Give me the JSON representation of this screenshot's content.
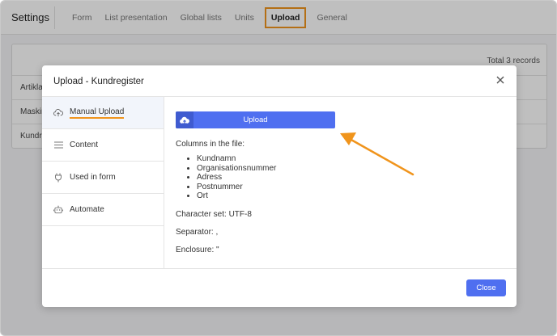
{
  "app": {
    "title": "Settings"
  },
  "tabs": [
    {
      "label": "Form"
    },
    {
      "label": "List presentation"
    },
    {
      "label": "Global lists"
    },
    {
      "label": "Units"
    },
    {
      "label": "Upload",
      "active": true
    },
    {
      "label": "General"
    }
  ],
  "background": {
    "total_records": "Total 3 records",
    "rows": [
      "Artiklar",
      "Maskin",
      "Kundre"
    ]
  },
  "modal": {
    "title": "Upload - Kundregister",
    "nav": [
      {
        "label": "Manual Upload",
        "icon": "cloud-upload-icon",
        "active": true
      },
      {
        "label": "Content",
        "icon": "list-icon"
      },
      {
        "label": "Used in form",
        "icon": "plug-icon"
      },
      {
        "label": "Automate",
        "icon": "robot-icon"
      }
    ],
    "upload_button_label": "Upload",
    "columns_title": "Columns in the file:",
    "columns": [
      "Kundnamn",
      "Organisationsnummer",
      "Adress",
      "Postnummer",
      "Ort"
    ],
    "charset": "Character set: UTF-8",
    "separator": "Separator: ,",
    "enclosure": "Enclosure: \"",
    "close_label": "Close"
  },
  "colors": {
    "accent": "#4f6ff0",
    "highlight": "#f0941c"
  }
}
